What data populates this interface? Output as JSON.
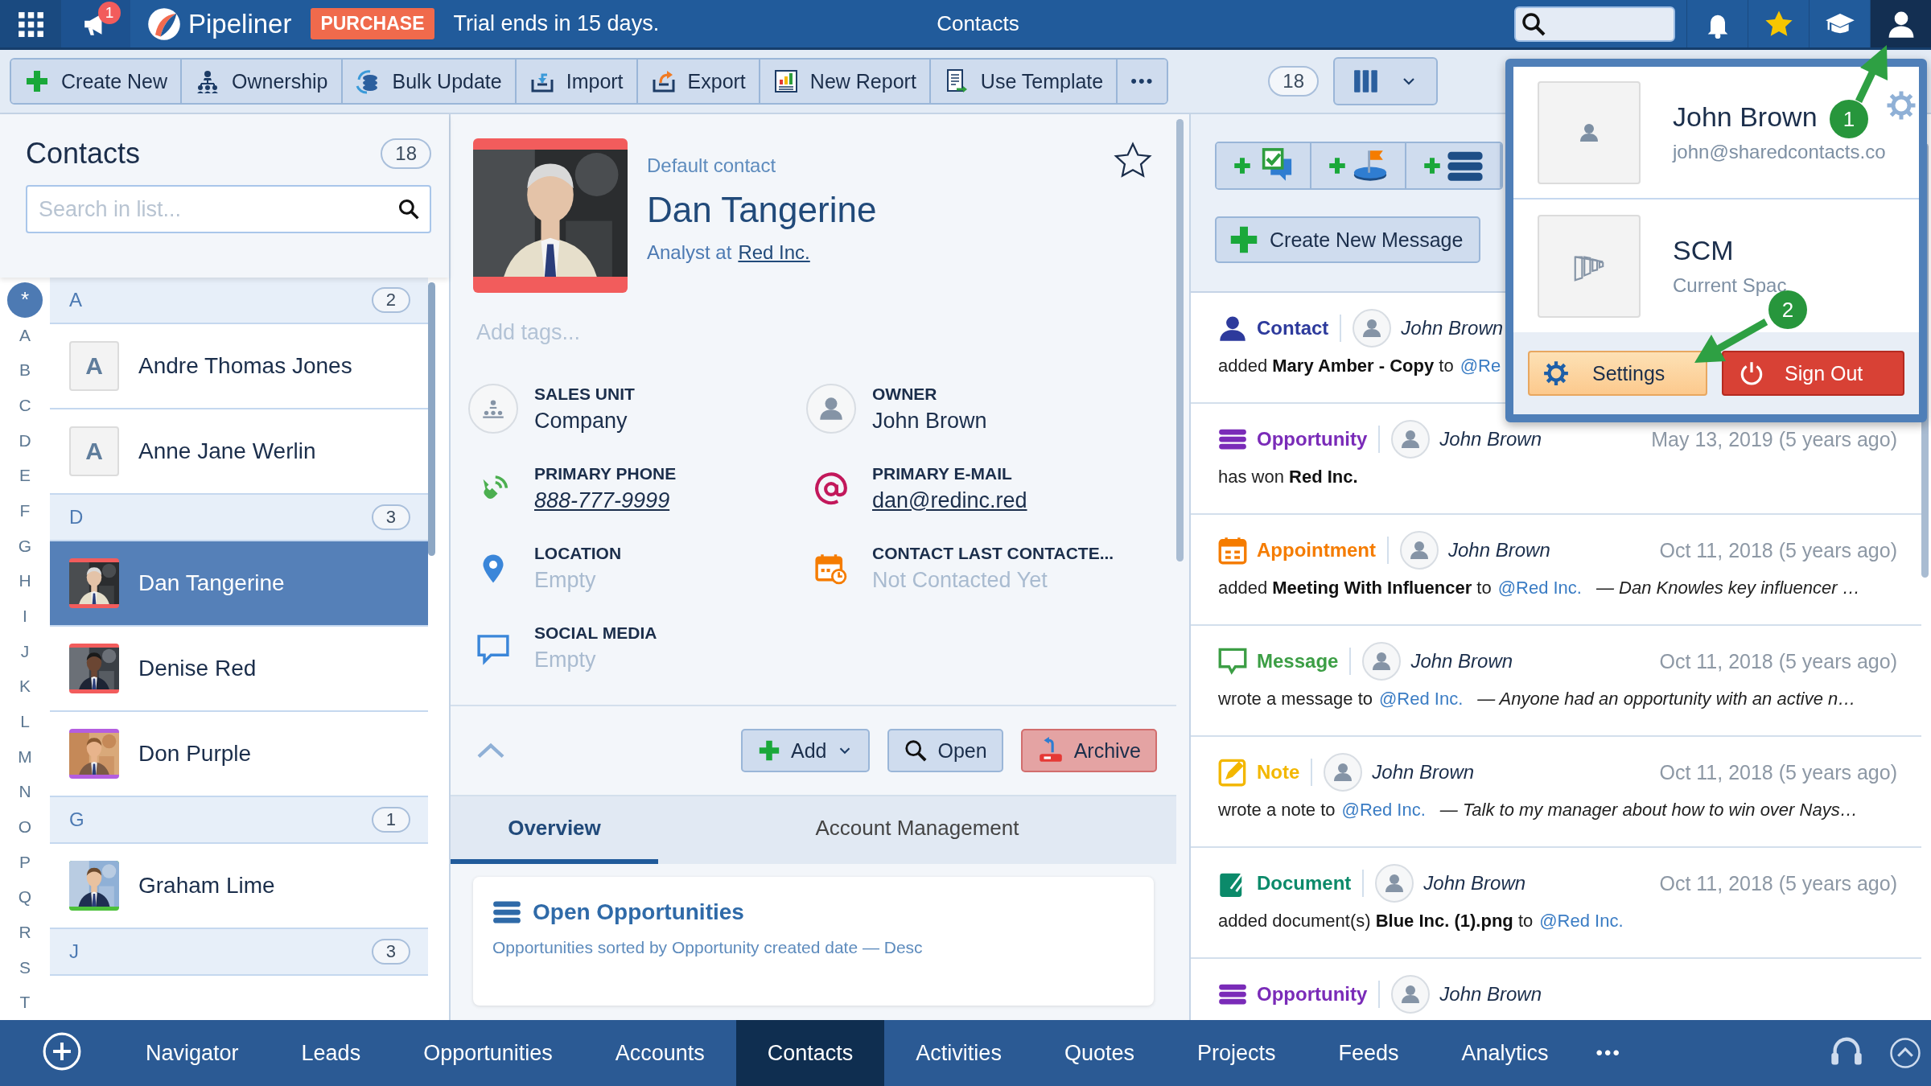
{
  "top_bar": {
    "notification_count": "1",
    "app_name": "Pipeliner",
    "purchase": "PURCHASE",
    "trial": "Trial ends in 15 days.",
    "title": "Contacts",
    "icons": [
      {
        "kind": "bell",
        "selected": false
      },
      {
        "kind": "star",
        "selected": false
      },
      {
        "kind": "education",
        "selected": false
      },
      {
        "kind": "user",
        "selected": true
      }
    ]
  },
  "toolbar": {
    "buttons": [
      {
        "kind": "create",
        "label": "Create New"
      },
      {
        "kind": "ownership",
        "label": "Ownership"
      },
      {
        "kind": "bulk",
        "label": "Bulk Update"
      },
      {
        "kind": "import",
        "label": "Import"
      },
      {
        "kind": "export",
        "label": "Export"
      },
      {
        "kind": "report",
        "label": "New Report"
      },
      {
        "kind": "template",
        "label": "Use Template"
      }
    ],
    "more": "•••",
    "count": "18"
  },
  "list": {
    "title": "Contacts",
    "count": "18",
    "search_placeholder": "Search in list...",
    "alphabet": [
      {
        "letter": "*",
        "selected": true
      },
      {
        "letter": "A",
        "selected": false
      },
      {
        "letter": "B",
        "selected": false
      },
      {
        "letter": "C",
        "selected": false
      },
      {
        "letter": "D",
        "selected": false
      },
      {
        "letter": "E",
        "selected": false
      },
      {
        "letter": "F",
        "selected": false
      },
      {
        "letter": "G",
        "selected": false
      },
      {
        "letter": "H",
        "selected": false
      },
      {
        "letter": "I",
        "selected": false
      },
      {
        "letter": "J",
        "selected": false
      },
      {
        "letter": "K",
        "selected": false
      },
      {
        "letter": "L",
        "selected": false
      },
      {
        "letter": "M",
        "selected": false
      },
      {
        "letter": "N",
        "selected": false
      },
      {
        "letter": "O",
        "selected": false
      },
      {
        "letter": "P",
        "selected": false
      },
      {
        "letter": "Q",
        "selected": false
      },
      {
        "letter": "R",
        "selected": false
      },
      {
        "letter": "S",
        "selected": false
      },
      {
        "letter": "T",
        "selected": false
      }
    ],
    "groups": [
      {
        "letter": "A",
        "count": "2",
        "items": [
          {
            "kind": "initial",
            "initial": "A",
            "name": "Andre Thomas Jones",
            "selected": false
          },
          {
            "kind": "initial",
            "initial": "A",
            "name": "Anne Jane Werlin",
            "selected": false
          }
        ]
      },
      {
        "letter": "D",
        "count": "3",
        "items": [
          {
            "color": "#f25c5c",
            "name": "Dan Tangerine",
            "selected": true
          },
          {
            "color": "#f25c5c",
            "name": "Denise Red",
            "selected": false
          },
          {
            "color": "#b45ee0",
            "name": "Don Purple",
            "selected": false
          }
        ]
      },
      {
        "letter": "G",
        "count": "1",
        "items": [
          {
            "color": "#4cc13a",
            "name": "Graham Lime",
            "selected": false
          }
        ]
      },
      {
        "letter": "J",
        "count": "3"
      }
    ]
  },
  "detail": {
    "label": "Default contact",
    "name": "Dan Tangerine",
    "position": "Analyst at",
    "company": "Red Inc.",
    "color": "#f25c5c",
    "favorite": false,
    "tags_placeholder": "Add tags...",
    "fields": [
      {
        "kind": "sales_unit",
        "label": "SALES UNIT",
        "value": "Company",
        "link": false,
        "empty": false
      },
      {
        "kind": "owner",
        "label": "OWNER",
        "value": "John Brown",
        "link": false,
        "empty": false
      },
      {
        "kind": "phone",
        "label": "PRIMARY PHONE",
        "value": "888-777-9999",
        "link": true,
        "empty": false
      },
      {
        "kind": "email",
        "label": "PRIMARY E-MAIL",
        "value": "dan@redinc.red",
        "link": true,
        "empty": false
      },
      {
        "kind": "location",
        "label": "LOCATION",
        "value": "Empty",
        "link": false,
        "empty": true
      },
      {
        "kind": "last_contacted",
        "label": "CONTACT LAST CONTACTE...",
        "value": "Not Contacted Yet",
        "link": false,
        "empty": true
      },
      {
        "kind": "social",
        "label": "SOCIAL MEDIA",
        "value": "Empty",
        "link": false,
        "empty": true
      }
    ],
    "actions": [
      {
        "kind": "add",
        "label": "Add"
      },
      {
        "kind": "open",
        "label": "Open"
      },
      {
        "kind": "archive",
        "label": "Archive"
      }
    ],
    "tabs": [
      {
        "label": "Overview",
        "selected": true
      },
      {
        "label": "Account Management",
        "selected": false
      }
    ],
    "card": {
      "title": "Open Opportunities",
      "subtitle": "Opportunities sorted by Opportunity created date — Desc"
    }
  },
  "feed": {
    "quick_actions": [
      {
        "kind": "task"
      },
      {
        "kind": "milestone"
      },
      {
        "kind": "list"
      }
    ],
    "create_message": "Create New Message",
    "items": [
      {
        "kind": "contact",
        "type": "Contact",
        "color": "#2d3a9c",
        "user": "John Brown",
        "text": "added **Mary Amber - Copy** to",
        "mention": "@Re"
      },
      {
        "kind": "opportunity",
        "type": "Opportunity",
        "color": "#7a2bb8",
        "user": "John Brown",
        "date": "May 13, 2019 (5 years ago)",
        "text": "has won **Red Inc.**"
      },
      {
        "kind": "appointment",
        "type": "Appointment",
        "color": "#f57c00",
        "user": "John Brown",
        "date": "Oct 11, 2018 (5 years ago)",
        "text": "added **Meeting With Influencer** to",
        "mention": "@Red Inc.",
        "note": "— Dan Knowles key influencer …"
      },
      {
        "kind": "message",
        "type": "Message",
        "color": "#3c9e45",
        "user": "John Brown",
        "date": "Oct 11, 2018 (5 years ago)",
        "text": "wrote a message to",
        "mention": "@Red Inc.",
        "note": "— Anyone had an opportunity with an active n…"
      },
      {
        "kind": "note",
        "type": "Note",
        "color": "#f3b700",
        "user": "John Brown",
        "date": "Oct 11, 2018 (5 years ago)",
        "text": "wrote a note to",
        "mention": "@Red Inc.",
        "note": "— Talk to my manager about how to win over Nays…"
      },
      {
        "kind": "document",
        "type": "Document",
        "color": "#0b8a6a",
        "user": "John Brown",
        "date": "Oct 11, 2018 (5 years ago)",
        "text": "added document(s) **Blue Inc. (1).png** to",
        "mention": "@Red Inc."
      },
      {
        "kind": "opportunity",
        "type": "Opportunity",
        "color": "#7a2bb8",
        "user": "John Brown"
      }
    ]
  },
  "popup": {
    "user_name": "John Brown",
    "email": "john@sharedcontacts.co",
    "space_name": "SCM",
    "space_label": "Current Spac",
    "settings": "Settings",
    "sign_out": "Sign Out"
  },
  "bottom_nav": {
    "items": [
      {
        "label": "Navigator",
        "selected": false
      },
      {
        "label": "Leads",
        "selected": false
      },
      {
        "label": "Opportunities",
        "selected": false
      },
      {
        "label": "Accounts",
        "selected": false
      },
      {
        "label": "Contacts",
        "selected": true
      },
      {
        "label": "Activities",
        "selected": false
      },
      {
        "label": "Quotes",
        "selected": false
      },
      {
        "label": "Projects",
        "selected": false
      },
      {
        "label": "Feeds",
        "selected": false
      },
      {
        "label": "Analytics",
        "selected": false
      }
    ],
    "more": "•••"
  },
  "annotations": [
    {
      "number": "1"
    },
    {
      "number": "2"
    }
  ]
}
